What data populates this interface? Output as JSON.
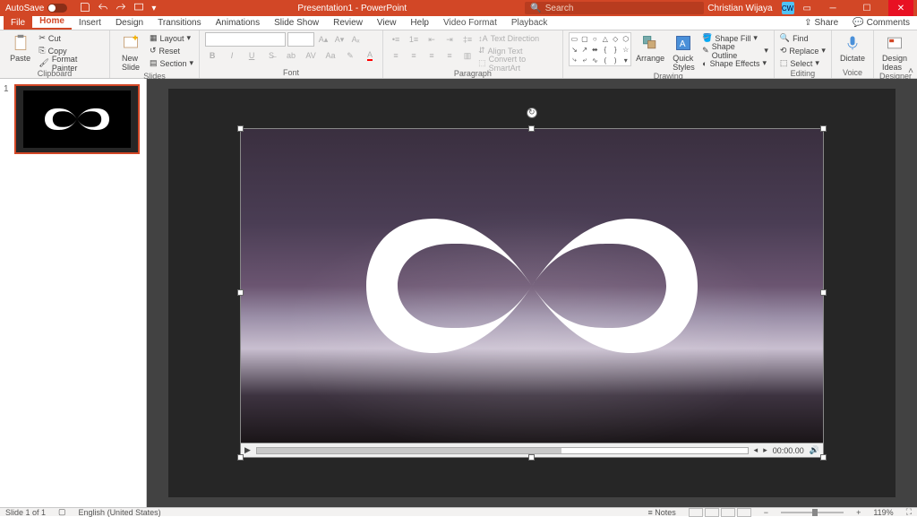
{
  "titlebar": {
    "autosave_label": "AutoSave",
    "title": "Presentation1 - PowerPoint",
    "search_placeholder": "Search",
    "user_name": "Christian Wijaya",
    "user_initials": "CW"
  },
  "tabs": {
    "file": "File",
    "items": [
      "Home",
      "Insert",
      "Design",
      "Transitions",
      "Animations",
      "Slide Show",
      "Review",
      "View",
      "Help",
      "Video Format",
      "Playback"
    ],
    "active": "Home",
    "share": "Share",
    "comments": "Comments"
  },
  "ribbon": {
    "clipboard": {
      "paste": "Paste",
      "cut": "Cut",
      "copy": "Copy",
      "format_painter": "Format Painter",
      "label": "Clipboard"
    },
    "slides": {
      "new_slide": "New\nSlide",
      "layout": "Layout",
      "reset": "Reset",
      "section": "Section",
      "label": "Slides"
    },
    "font": {
      "label": "Font"
    },
    "paragraph": {
      "text_direction": "Text Direction",
      "align_text": "Align Text",
      "convert_smartart": "Convert to SmartArt",
      "label": "Paragraph"
    },
    "drawing": {
      "arrange": "Arrange",
      "quick_styles": "Quick\nStyles",
      "shape_fill": "Shape Fill",
      "shape_outline": "Shape Outline",
      "shape_effects": "Shape Effects",
      "label": "Drawing"
    },
    "editing": {
      "find": "Find",
      "replace": "Replace",
      "select": "Select",
      "label": "Editing"
    },
    "voice": {
      "dictate": "Dictate",
      "label": "Voice"
    },
    "designer": {
      "design_ideas": "Design\nIdeas",
      "label": "Designer"
    }
  },
  "video": {
    "time": "00:00.00"
  },
  "statusbar": {
    "slide_info": "Slide 1 of 1",
    "language": "English (United States)",
    "notes": "Notes",
    "zoom": "119%"
  },
  "thumb": {
    "number": "1"
  }
}
